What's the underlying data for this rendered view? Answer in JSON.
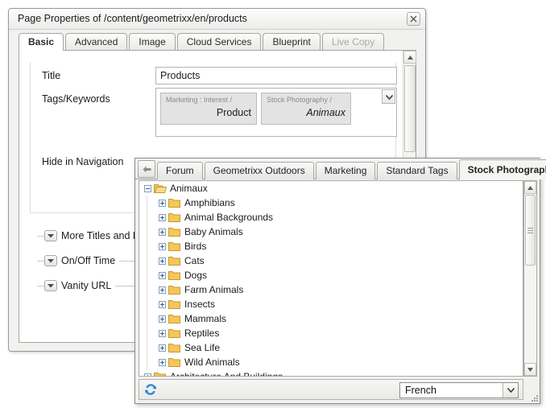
{
  "dialog": {
    "title": "Page Properties of /content/geometrixx/en/products",
    "close_icon": "close-icon",
    "tabs": [
      {
        "label": "Basic",
        "active": true,
        "disabled": false
      },
      {
        "label": "Advanced",
        "active": false,
        "disabled": false
      },
      {
        "label": "Image",
        "active": false,
        "disabled": false
      },
      {
        "label": "Cloud Services",
        "active": false,
        "disabled": false
      },
      {
        "label": "Blueprint",
        "active": false,
        "disabled": false
      },
      {
        "label": "Live Copy",
        "active": false,
        "disabled": true
      }
    ],
    "form": {
      "title_label": "Title",
      "title_value": "Products",
      "tags_label": "Tags/Keywords",
      "hide_in_nav_label": "Hide in Navigation",
      "tags": [
        {
          "path": "Marketing : Interest /",
          "name": "Product",
          "italic": false
        },
        {
          "path": "Stock Photography /",
          "name": "Animaux",
          "italic": true
        }
      ],
      "tags_dropdown_icon": "chevron-down-icon"
    },
    "sections": [
      {
        "label": "More Titles and Description",
        "toggle_icon": "chevron-down-icon"
      },
      {
        "label": "On/Off Time",
        "toggle_icon": "chevron-down-icon"
      },
      {
        "label": "Vanity URL",
        "toggle_icon": "chevron-down-icon"
      }
    ],
    "scrollbar": {
      "up_icon": "triangle-up-icon",
      "down_icon": "triangle-down-icon"
    }
  },
  "picker": {
    "prev_tab_icon": "arrow-left-icon",
    "next_tab_icon": "arrow-right-icon",
    "tabs": [
      {
        "label": "Forum",
        "active": false
      },
      {
        "label": "Geometrixx Outdoors",
        "active": false
      },
      {
        "label": "Marketing",
        "active": false
      },
      {
        "label": "Standard Tags",
        "active": false
      },
      {
        "label": "Stock Photography",
        "active": true
      }
    ],
    "tree": [
      {
        "label": "Animaux",
        "depth": 0,
        "state": "expanded",
        "icon": "folder-open-icon"
      },
      {
        "label": "Amphibians",
        "depth": 1,
        "state": "collapsed",
        "icon": "folder-icon"
      },
      {
        "label": "Animal Backgrounds",
        "depth": 1,
        "state": "collapsed",
        "icon": "folder-icon"
      },
      {
        "label": "Baby Animals",
        "depth": 1,
        "state": "collapsed",
        "icon": "folder-icon"
      },
      {
        "label": "Birds",
        "depth": 1,
        "state": "collapsed",
        "icon": "folder-icon"
      },
      {
        "label": "Cats",
        "depth": 1,
        "state": "collapsed",
        "icon": "folder-icon"
      },
      {
        "label": "Dogs",
        "depth": 1,
        "state": "collapsed",
        "icon": "folder-icon"
      },
      {
        "label": "Farm Animals",
        "depth": 1,
        "state": "collapsed",
        "icon": "folder-icon"
      },
      {
        "label": "Insects",
        "depth": 1,
        "state": "collapsed",
        "icon": "folder-icon"
      },
      {
        "label": "Mammals",
        "depth": 1,
        "state": "collapsed",
        "icon": "folder-icon"
      },
      {
        "label": "Reptiles",
        "depth": 1,
        "state": "collapsed",
        "icon": "folder-icon"
      },
      {
        "label": "Sea Life",
        "depth": 1,
        "state": "collapsed",
        "icon": "folder-icon"
      },
      {
        "label": "Wild Animals",
        "depth": 1,
        "state": "collapsed",
        "icon": "folder-icon"
      },
      {
        "label": "Architecture And Buildings",
        "depth": 0,
        "state": "collapsed",
        "icon": "folder-icon"
      }
    ],
    "bottom": {
      "refresh_icon": "refresh-icon",
      "language_value": "French",
      "language_dropdown_icon": "chevron-down-icon"
    },
    "scrollbar": {
      "up_icon": "triangle-up-icon",
      "down_icon": "triangle-down-icon"
    }
  },
  "colors": {
    "folder": "#f5c75a",
    "folder_edge": "#c79a28",
    "expander_border": "#7d9ec0",
    "refresh_blue": "#1f6fc4"
  }
}
